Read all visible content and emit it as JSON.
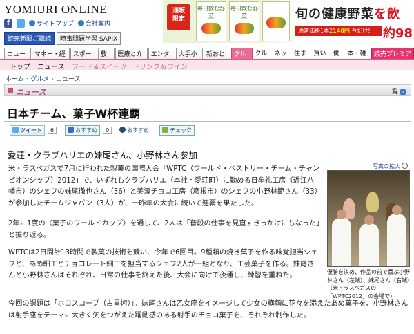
{
  "header": {
    "logo": "YOMIURI ONLINE",
    "sitemap": "サイトマップ",
    "company": "会社案内",
    "btn_subscribe": "読売新聞ご購読",
    "btn_sapix": "時事問題学習 SAPIX",
    "fb_glyph": "f"
  },
  "ad": {
    "badge_line1": "通販",
    "badge_line2": "限定",
    "pack_label": "毎日飲む野菜",
    "title_a": "旬の健康野菜",
    "title_b": "を飲",
    "strip_text": "通常価格1本2",
    "strip_price": "140円",
    "strip_tail": "今だけ!",
    "big_price": "約98"
  },
  "nav": {
    "items": [
      "ニュース",
      "マネー・経済",
      "スポーツ",
      "教育",
      "医療と介護",
      "エンタメ",
      "大手小町",
      "新おとな",
      "グルメ",
      "クルマ",
      "ネット",
      "住まい",
      "買い物",
      "働く",
      "本・雑誌",
      "読売プレミアム"
    ]
  },
  "subnav": {
    "items": [
      "トップ",
      "ニュース",
      "フード＆スイーツ",
      "ドリンク＆ワイン"
    ]
  },
  "breadcrumb": [
    "ホーム",
    "グルメ",
    "ニュース"
  ],
  "section": {
    "title": "ニュース",
    "list_link": "一覧"
  },
  "article": {
    "headline": "日本チーム、菓子W杯連覇",
    "subhead": "愛荘・クラブハリエの妹尾さん、小野林さん参加",
    "paragraphs": [
      "米・ラスベガスで7月に行われた製菓の国際大会「WPTC（ワールド・ペストリー・チーム・チャンピオンシップ）2012」で、いずれもクラブハリエ（本社・愛荘町）に勤める日牟礼工房（近江八幡市）のシェフの妹尾徹也さん（36）と美濠チョコ工房（彦根市）のシェフの小野林範さん（33）が参加したチームジャパン（3人）が、一昨年の大会に続いて連覇を果たした。",
      "2年に1度の〈菓子のワールドカップ〉を通して、2人は「普段の仕事を見直すきっかけにもなった」と振り返る。",
      "WPTCは2日間計13時間で製菓の技術を競い、今年で6回目。9種類の焼き菓子を作る味覚担当シェフと、あめ細工とチョコレート細工を担当するシェフ2人が一組となり、工芸菓子を作る。妹尾さんと小野林さんはそれぞれ、日常の仕事を終えた後、大会に向けて夜通し、練習を重ねた。",
      "今回の課題は「ホロスコープ（占星術）」。妹尾さんは乙女座をイメージして少女の横顔に花々を添えたあめ菓子を、小野林さんは射手座をテーマに大きく矢をつがえた躍動感のある射手のチョコ菓子を、それぞれ制作した。"
    ]
  },
  "social": {
    "tweet": "ツイート",
    "tweet_count": "6",
    "recommend1": "おすすめ",
    "recommend1_count": "0",
    "recommend2": "おすすめ",
    "check": "チェック"
  },
  "photo": {
    "link": "写真の拡大",
    "caption": "優勝を決め、作品の前で喜ぶ小野林さん（左端）、妹尾さん（右端）（米・ラスベガスの「WPTC2012」の会場で）"
  }
}
